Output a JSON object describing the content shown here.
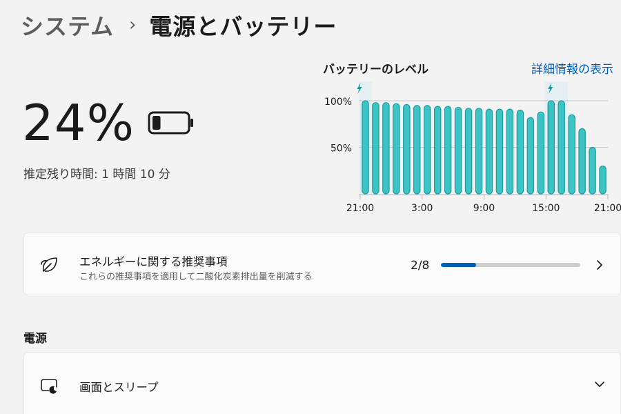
{
  "breadcrumb": {
    "parent": "システム",
    "separator": "›",
    "current": "電源とバッテリー"
  },
  "battery": {
    "percent_label": "24%",
    "percent": 24,
    "remaining_label": "推定残り時間: 1 時間 10 分",
    "icon": "battery-low-icon"
  },
  "chart_header": {
    "title": "バッテリーのレベル",
    "details_link": "詳細情報の表示"
  },
  "chart_data": {
    "type": "bar",
    "title": "バッテリーのレベル",
    "categories": [
      "21:00",
      "",
      "",
      "",
      "",
      "3:00",
      "",
      "",
      "",
      "",
      "",
      "9:00",
      "",
      "",
      "",
      "",
      "",
      "15:00",
      "",
      "",
      "",
      "",
      "",
      "21:00"
    ],
    "x_tick_labels": [
      "21:00",
      "3:00",
      "9:00",
      "15:00",
      "21:00"
    ],
    "values": [
      100,
      98,
      98,
      97,
      96,
      95,
      95,
      94,
      94,
      93,
      92,
      92,
      91,
      91,
      91,
      90,
      82,
      88,
      100,
      100,
      85,
      70,
      50,
      30
    ],
    "y_tick_labels": [
      "100%",
      "50%"
    ],
    "ylim": [
      0,
      100
    ],
    "charging_periods": [
      [
        0,
        0
      ],
      [
        18,
        19
      ]
    ],
    "grid": true,
    "bar_color": "#3cc4c4",
    "bar_outline_color": "#1f9a9f",
    "charging_icon": "lightning-icon"
  },
  "energy_card": {
    "icon": "leaf-icon",
    "title": "エネルギーに関する推奨事項",
    "subtitle": "これらの推奨事項を適用して二酸化炭素排出量を削減する",
    "progress_label": "2/8",
    "progress_value": 0.25
  },
  "power_section": {
    "heading": "電源",
    "sleep_card": {
      "icon": "screen-sleep-icon",
      "title": "画面とスリープ"
    }
  },
  "colors": {
    "accent": "#005fb8",
    "background": "#f3f3f3",
    "card": "#fbfbfb"
  }
}
